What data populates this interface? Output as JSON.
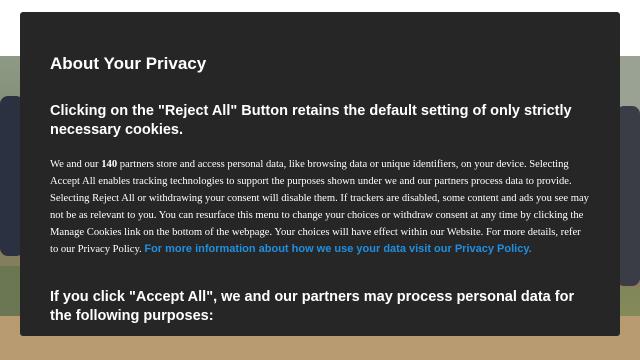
{
  "dialog": {
    "title": "About Your Privacy",
    "reject_heading": "Clicking on the \"Reject All\" Button retains the default setting of only strictly necessary cookies.",
    "body": {
      "prefix": "We and our ",
      "partner_count": "140",
      "text": " partners store and access personal data, like browsing data or unique identifiers, on your device. Selecting Accept All enables tracking technologies to support the purposes shown under we and our partners process data to provide. Selecting Reject All or withdrawing your consent will disable them. If trackers are disabled, some content and ads you see may not be as relevant to you. You can resurface this menu to change your choices or withdraw consent at any time by clicking the Manage Cookies link on the bottom of the webpage. Your choices will have effect within our Website. For more details, refer to our Privacy Policy. ",
      "link_text": "For more information about how we use your data visit our Privacy Policy."
    },
    "accept_heading": "If you click \"Accept All\", we and our partners may process personal data for the following purposes:"
  },
  "colors": {
    "dialog_bg": "#262626",
    "text": "#ffffff",
    "link": "#1f8fe0"
  }
}
